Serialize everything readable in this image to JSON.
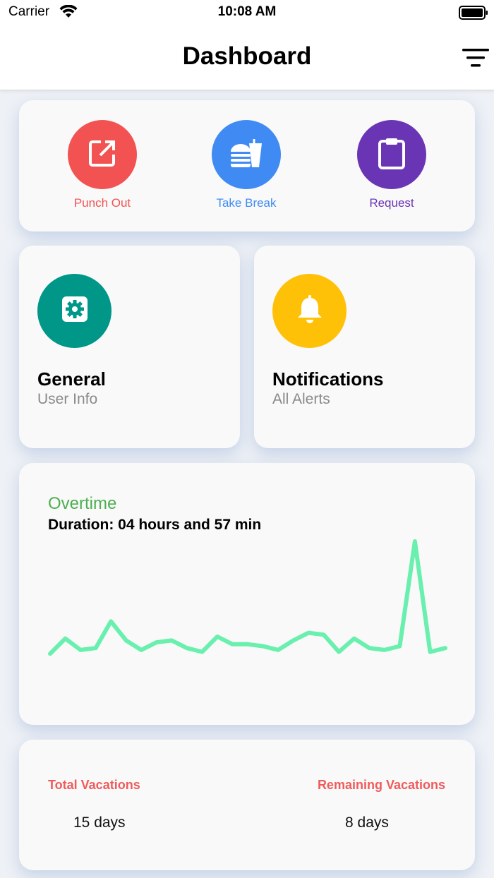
{
  "status_bar": {
    "carrier": "Carrier",
    "time": "10:08 AM"
  },
  "header": {
    "title": "Dashboard"
  },
  "quick_actions": [
    {
      "label": "Punch Out",
      "color": "#f25252",
      "icon": "edit-external-icon"
    },
    {
      "label": "Take Break",
      "color": "#3f8bf3",
      "icon": "food-drink-icon"
    },
    {
      "label": "Request",
      "color": "#6a35b5",
      "icon": "clipboard-icon"
    }
  ],
  "tiles": [
    {
      "title": "General",
      "subtitle": "User Info",
      "color": "#009688",
      "icon": "gear-icon"
    },
    {
      "title": "Notifications",
      "subtitle": "All Alerts",
      "color": "#ffc107",
      "icon": "bell-icon"
    }
  ],
  "overtime": {
    "title": "Overtime",
    "duration": "Duration: 04 hours and 57 min",
    "line_color": "#69f0ae"
  },
  "chart_data": {
    "type": "line",
    "x": [
      1,
      2,
      3,
      4,
      5,
      6,
      7,
      8,
      9,
      10,
      11,
      12,
      13,
      14,
      15,
      16,
      17,
      18,
      19,
      20,
      21,
      22,
      23,
      24,
      25,
      26,
      27
    ],
    "values": [
      1,
      9,
      3,
      4,
      18,
      8,
      3,
      7,
      8,
      4,
      2,
      10,
      6,
      6,
      5,
      3,
      8,
      12,
      11,
      2,
      9,
      4,
      3,
      5,
      60,
      2,
      4
    ],
    "ylim": [
      0,
      60
    ]
  },
  "vacations": {
    "total_label": "Total Vacations",
    "total_value": "15 days",
    "remaining_label": "Remaining Vacations",
    "remaining_value": "8 days"
  }
}
